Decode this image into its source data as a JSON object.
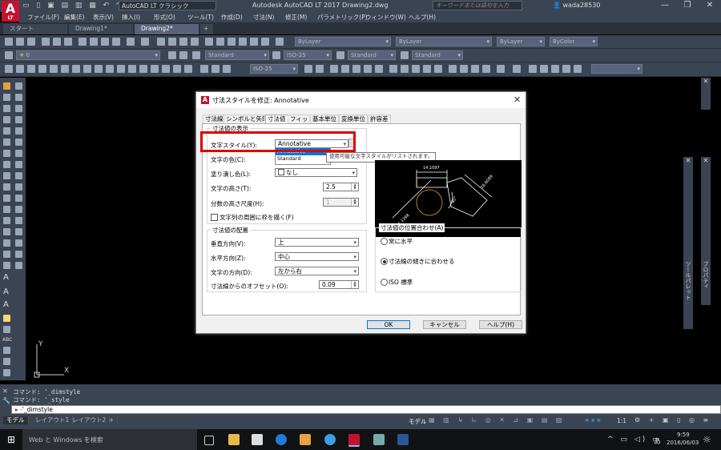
{
  "titlebar": {
    "logo_letter": "A",
    "logo_sub": "LT",
    "workspace": "AutoCAD LT クラシック",
    "title": "Autodesk AutoCAD LT 2017    Drawing2.dwg",
    "search_placeholder": "キーワードまたは語句を入力",
    "user": "wada28530",
    "minimize": "—",
    "restore": "❐",
    "close": "✕"
  },
  "menu": [
    "ファイル(F)",
    "編集(E)",
    "表示(V)",
    "挿入(I)",
    "形式(O)",
    "ツール(T)",
    "作成(D)",
    "寸法(N)",
    "修正(M)",
    "パラメトリック(P)",
    "ウィンドウ(W)",
    "ヘルプ(H)"
  ],
  "tabs": [
    "スタート",
    "Drawing1*",
    "Drawing2*",
    "+"
  ],
  "toolbar1": {
    "bylayer_color": "ByLayer",
    "bylayer_linetype": "ByLayer",
    "bylayer_lineweight": "ByLayer",
    "bycolor": "ByColor"
  },
  "toolbar2": {
    "layer": "0",
    "text_style": "Standard",
    "dim_style": "ISO-25",
    "table_style": "Standard",
    "mleader_style": "Standard"
  },
  "toolbar3": {
    "dim_style": "ISO-25"
  },
  "dialog": {
    "title": "寸法スタイルを修正: Annotative",
    "tabs": [
      "寸法線",
      "シンボルと矢印",
      "寸法値",
      "フィット",
      "基本単位",
      "変換単位",
      "許容差"
    ],
    "appearance_group": "寸法値の表示",
    "text_style_label": "文字スタイル(Y):",
    "text_style_value": "Annotative",
    "text_style_options": [
      "Annotative",
      "Standard"
    ],
    "tooltip": "使用可能な文字スタイルがリストされます。",
    "text_color_label": "文字の色(C):",
    "fill_color_label": "塗り潰し色(L):",
    "fill_color_value": "なし",
    "text_height_label": "文字の高さ(T):",
    "text_height_value": "2.5",
    "fraction_scale_label": "分数の高さ尺度(H):",
    "fraction_scale_value": "1",
    "frame_label": "文字列の周囲に枠を描く(F)",
    "placement_group": "寸法値の配置",
    "vertical_label": "垂直方向(V):",
    "vertical_value": "上",
    "horizontal_label": "水平方向(Z):",
    "horizontal_value": "中心",
    "view_direction_label": "文字の方向(D):",
    "view_direction_value": "左から右",
    "offset_label": "寸法線からのオフセット(O):",
    "offset_value": "0.09",
    "alignment_group": "寸法値の位置合わせ(A)",
    "align_horizontal": "常に水平",
    "align_dimline": "寸法線の傾きに合わせる",
    "align_iso": "ISO 標準",
    "ok": "OK",
    "cancel": "キャンセル",
    "help": "ヘルプ(H)",
    "preview_values": [
      "14.1097",
      "16.6089",
      "80°",
      "R11.1398"
    ]
  },
  "commands": [
    "コマンド: '_dimstyle",
    "コマンド: '_style"
  ],
  "command_input": "'_dimstyle",
  "palette_labels": {
    "properties": "プロパティ",
    "tool_palette": "ツールパレット"
  },
  "layout_tabs": [
    "モデル",
    "レイアウト1",
    "レイアウト2",
    "+"
  ],
  "status": {
    "model": "モデル",
    "scale": "1:1"
  },
  "taskbar": {
    "search": "Web と Windows を検索",
    "ime": "あ",
    "time": "9:59",
    "date": "2016/06/03"
  },
  "colors": {
    "highlight_red": "#e00000",
    "selection_blue": "#0078d7",
    "chrome": "#3b4453"
  }
}
